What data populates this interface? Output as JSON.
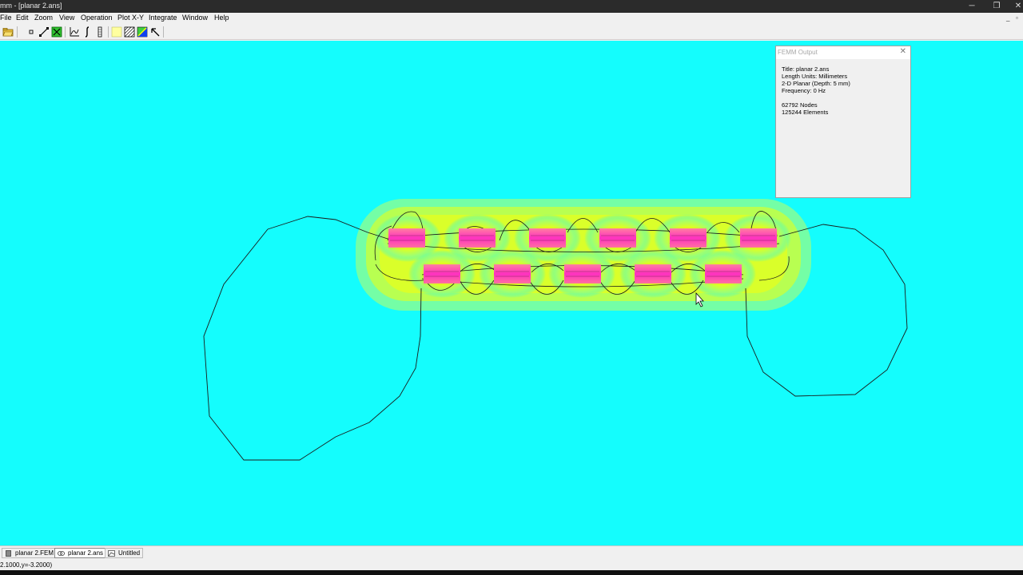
{
  "window": {
    "title": "mm - [planar 2.ans]",
    "minimize_glyph": "─",
    "restore_glyph": "❐",
    "close_glyph": "✕"
  },
  "menu": {
    "items": [
      "File",
      "Edit",
      "Zoom",
      "View",
      "Operation",
      "Plot X-Y",
      "Integrate",
      "Window",
      "Help"
    ],
    "mdi_minimize": "_",
    "mdi_restore": "▫"
  },
  "toolbar": {
    "icons": [
      "open-folder-icon",
      "point-icon",
      "contour-icon",
      "square-icon",
      "plot-icon",
      "integral-icon",
      "bar-icon",
      "blank-icon",
      "hatch-icon",
      "density-icon",
      "arrow-icon"
    ]
  },
  "output_window": {
    "title": "FEMM Output",
    "close_glyph": "✕",
    "lines": [
      "Title: planar 2.ans",
      "Length Units: Millimeters",
      "2-D Planar (Depth: 5 mm)",
      "Frequency: 0 Hz",
      "",
      "62792 Nodes",
      "125244 Elements"
    ]
  },
  "tabs": [
    {
      "label": "planar 2.FEM",
      "icon": "fem-file-icon",
      "active": false
    },
    {
      "label": "planar 2.ans",
      "icon": "analysis-file-icon",
      "active": true
    },
    {
      "label": "Untitled",
      "icon": "untitled-icon",
      "active": false
    }
  ],
  "status": {
    "coords": "2.1000,y=-3.2000)"
  },
  "colors": {
    "background": "#14fdfd",
    "field_low": "#14fdfd",
    "field_mid": "#c8ff40",
    "field_high": "#ffff00",
    "coil": "#ff40c0",
    "contour": "#1a1a1a"
  }
}
